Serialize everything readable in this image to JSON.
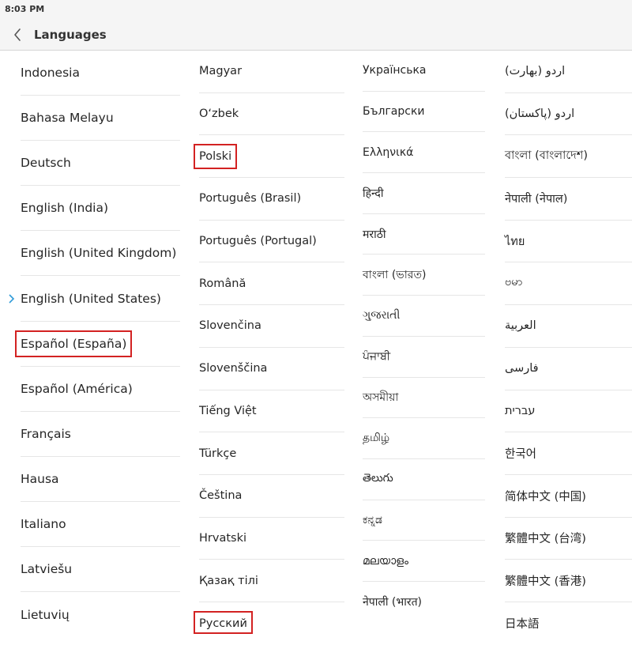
{
  "status_bar": {
    "time": "8:03 PM"
  },
  "header": {
    "title": "Languages"
  },
  "icons": {
    "back": "chevron-left-icon",
    "selected": "chevron-right-icon"
  },
  "colors": {
    "highlight": "#d32222",
    "selected_marker": "#2f9bd8"
  },
  "selected_language": "English (United States)",
  "highlighted_languages": [
    "Español (España)",
    "Polski",
    "Русский"
  ],
  "columns": [
    [
      "Indonesia",
      "Bahasa Melayu",
      "Deutsch",
      "English (India)",
      "English (United Kingdom)",
      "English (United States)",
      "Español (España)",
      "Español (América)",
      "Français",
      "Hausa",
      "Italiano",
      "Latviešu",
      "Lietuvių"
    ],
    [
      "Magyar",
      "O‘zbek",
      "Polski",
      "Português (Brasil)",
      "Português (Portugal)",
      "Română",
      "Slovenčina",
      "Slovenščina",
      "Tiếng Việt",
      "Türkçe",
      "Čeština",
      "Hrvatski",
      "Қазақ тілі",
      "Русский"
    ],
    [
      "Українська",
      "Български",
      "Ελληνικά",
      "हिन्दी",
      "मराठी",
      "বাংলা (ভারত)",
      "ગુજરાતી",
      "ਪੰਜਾਬੀ",
      "অসমীয়া",
      "தமிழ்",
      "తెలుగు",
      "ಕನ್ನಡ",
      "മലയാളം",
      "नेपाली (भारत)"
    ],
    [
      "اردو (بھارت)",
      "اردو (پاکستان)",
      "বাংলা (বাংলাদেশ)",
      "नेपाली (नेपाल)",
      "ไทย",
      "ဗမာ",
      "العربية",
      "فارسی",
      "עברית",
      "한국어",
      "简体中文 (中国)",
      "繁體中文 (台湾)",
      "繁體中文 (香港)",
      "日本語"
    ]
  ]
}
